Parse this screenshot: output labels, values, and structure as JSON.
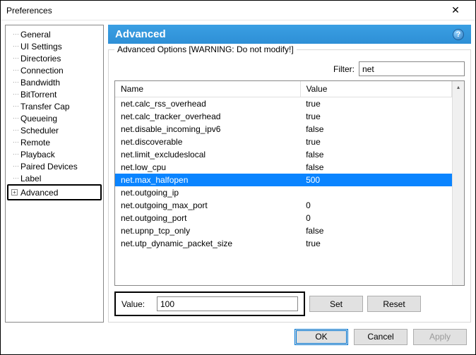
{
  "window": {
    "title": "Preferences"
  },
  "sidebar": {
    "items": [
      {
        "label": "General"
      },
      {
        "label": "UI Settings"
      },
      {
        "label": "Directories"
      },
      {
        "label": "Connection"
      },
      {
        "label": "Bandwidth"
      },
      {
        "label": "BitTorrent"
      },
      {
        "label": "Transfer Cap"
      },
      {
        "label": "Queueing"
      },
      {
        "label": "Scheduler"
      },
      {
        "label": "Remote"
      },
      {
        "label": "Playback"
      },
      {
        "label": "Paired Devices"
      },
      {
        "label": "Label"
      },
      {
        "label": "Advanced",
        "expandable": true
      }
    ]
  },
  "section": {
    "title": "Advanced",
    "group_label": "Advanced Options [WARNING: Do not modify!]",
    "filter_label": "Filter:",
    "filter_value": "net",
    "columns": {
      "name": "Name",
      "value": "Value"
    },
    "rows": [
      {
        "name": "net.calc_rss_overhead",
        "value": "true"
      },
      {
        "name": "net.calc_tracker_overhead",
        "value": "true"
      },
      {
        "name": "net.disable_incoming_ipv6",
        "value": "false"
      },
      {
        "name": "net.discoverable",
        "value": "true"
      },
      {
        "name": "net.limit_excludeslocal",
        "value": "false"
      },
      {
        "name": "net.low_cpu",
        "value": "false"
      },
      {
        "name": "net.max_halfopen",
        "value": "500",
        "selected": true
      },
      {
        "name": "net.outgoing_ip",
        "value": ""
      },
      {
        "name": "net.outgoing_max_port",
        "value": "0"
      },
      {
        "name": "net.outgoing_port",
        "value": "0"
      },
      {
        "name": "net.upnp_tcp_only",
        "value": "false"
      },
      {
        "name": "net.utp_dynamic_packet_size",
        "value": "true"
      }
    ],
    "value_label": "Value:",
    "value_input": "100",
    "set_label": "Set",
    "reset_label": "Reset"
  },
  "footer": {
    "ok": "OK",
    "cancel": "Cancel",
    "apply": "Apply"
  }
}
